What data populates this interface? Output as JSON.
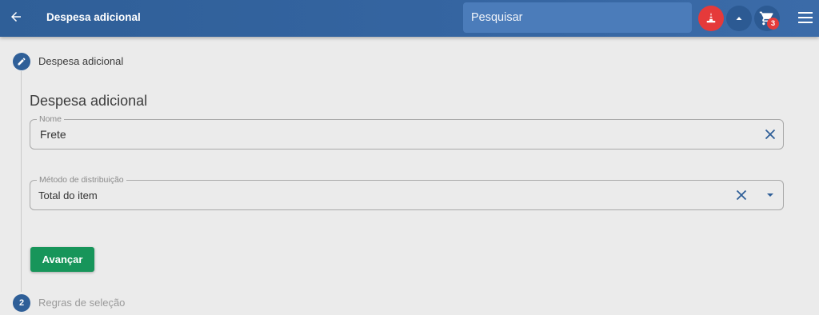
{
  "header": {
    "title": "Despesa adicional",
    "search_placeholder": "Pesquisar",
    "cart_count": "3",
    "icons": {
      "back": "arrow-left-icon",
      "alert": "traffic-cone-icon",
      "collapse": "caret-up-icon",
      "cart": "cart-icon",
      "menu": "hamburger-menu-icon"
    }
  },
  "stepper": {
    "step1": {
      "label": "Despesa adicional",
      "icon": "pencil-icon"
    },
    "step2": {
      "label": "Regras de seleção",
      "number": "2"
    }
  },
  "form": {
    "title": "Despesa adicional",
    "name_field": {
      "legend": "Nome",
      "value": "Frete"
    },
    "distribution_field": {
      "legend": "Método de distribuição",
      "value": "Total do item"
    },
    "advance_label": "Avançar"
  },
  "colors": {
    "header": "#3464a0",
    "accent_green": "#17955a",
    "alert_red": "#e53a3a",
    "icon_blue": "#2f5f98"
  }
}
